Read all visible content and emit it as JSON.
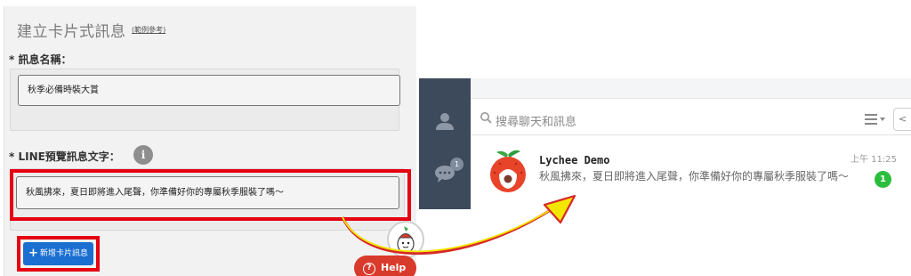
{
  "form": {
    "title": "建立卡片式訊息",
    "title_link": "(範例參考)",
    "name_label": "* 訊息名稱：",
    "name_value": "秋季必備時裝大賞",
    "preview_label": "* LINE預覽訊息文字：",
    "info_icon_glyph": "i",
    "preview_value": "秋風拂來，夏日即將進入尾聲，你準備好你的專屬秋季服裝了嗎～",
    "add_button_plus": "+",
    "add_button_label": "新增卡片訊息",
    "help_glyph": "?",
    "help_label": "Help"
  },
  "chat": {
    "search_placeholder": "搜尋聊天和訊息",
    "collapse_glyph": "<",
    "side_badge": "1",
    "item": {
      "name": "Lychee Demo",
      "time": "上午 11:25",
      "message": "秋風拂來，夏日即將進入尾聲，你準備好你的專屬秋季服裝了嗎～",
      "unread": "1"
    }
  },
  "colors": {
    "highlight_red": "#e50012",
    "button_blue": "#1a6fd1",
    "help_red": "#d83a2b",
    "sidebar_navy": "#3d4a5c",
    "badge_green": "#2bbe3e",
    "arrow_yellow": "#f3e600"
  },
  "icons": [
    "info-icon",
    "plus-icon",
    "help-icon",
    "mascot-icon",
    "user-icon",
    "chat-bubble-icon",
    "search-icon",
    "list-icon",
    "chevron-left-icon",
    "lychee-logo",
    "curved-arrow"
  ]
}
